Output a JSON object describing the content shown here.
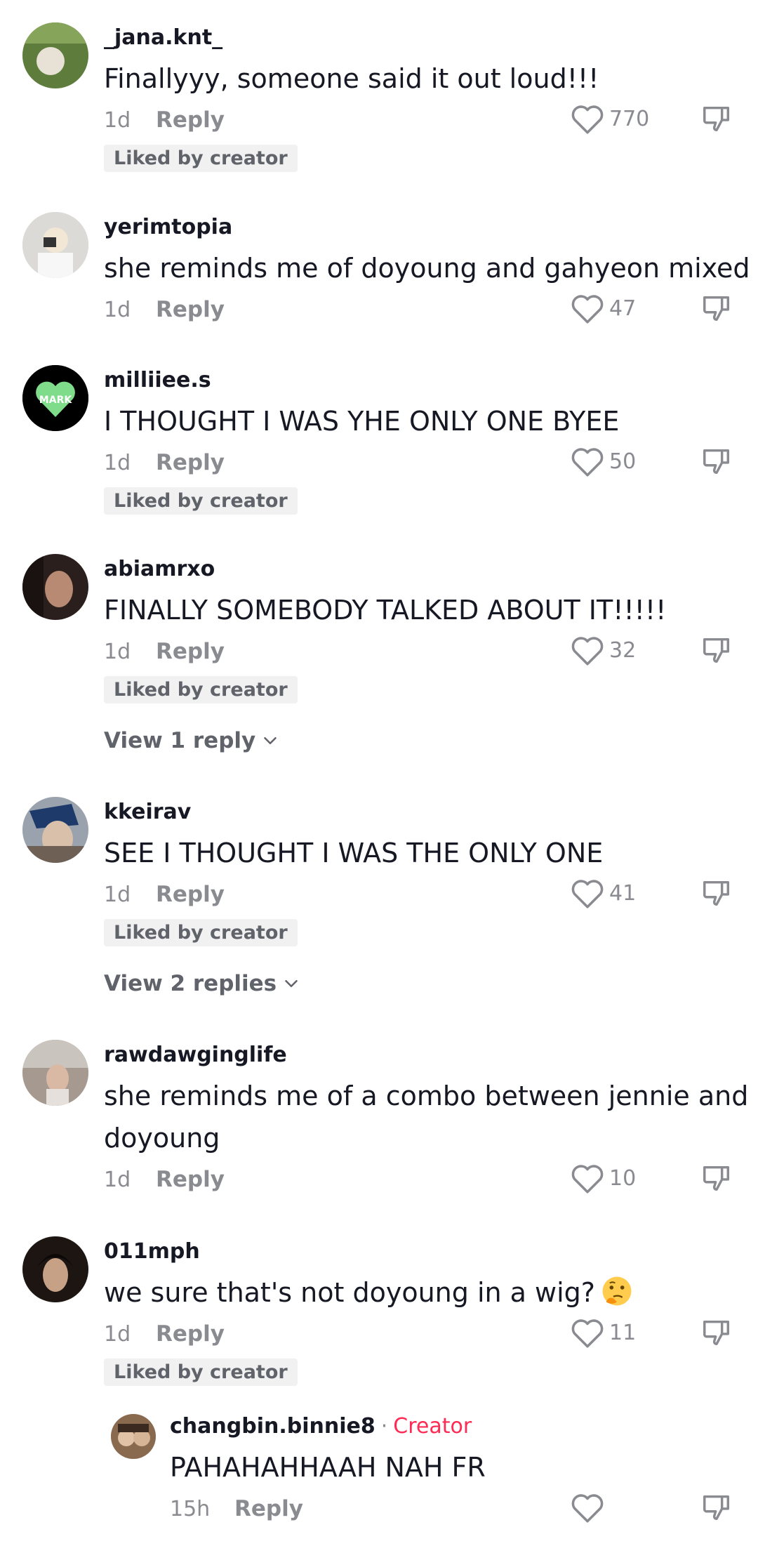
{
  "comments": [
    {
      "username": "_jana.knt_",
      "text": "Finallyyy, someone said it out loud!!!",
      "time": "1d",
      "reply": "Reply",
      "likes": "770",
      "badge": "Liked by creator",
      "avatar_color": "#5a7a3a"
    },
    {
      "username": "yerimtopia",
      "text": "she reminds me of doyoung and gahyeon mixed",
      "time": "1d",
      "reply": "Reply",
      "likes": "47",
      "avatar_color": "#d8d6d2"
    },
    {
      "username": "milliiee.s",
      "text": "I THOUGHT I WAS YHE ONLY ONE BYEE",
      "time": "1d",
      "reply": "Reply",
      "likes": "50",
      "badge": "Liked by creator",
      "avatar_color": "#000000"
    },
    {
      "username": "abiamrxo",
      "text": "FINALLY SOMEBODY TALKED ABOUT IT!!!!!",
      "time": "1d",
      "reply": "Reply",
      "likes": "32",
      "badge": "Liked by creator",
      "view_replies": "View 1 reply",
      "avatar_color": "#3a2a26"
    },
    {
      "username": "kkeirav",
      "text": "SEE I THOUGHT I WAS THE ONLY ONE",
      "time": "1d",
      "reply": "Reply",
      "likes": "41",
      "badge": "Liked by creator",
      "view_replies": "View 2 replies",
      "avatar_color": "#6b7684"
    },
    {
      "username": "rawdawginglife",
      "text": "she reminds me of a combo between jennie and",
      "text2": "doyoung",
      "time": "1d",
      "reply": "Reply",
      "likes": "10",
      "avatar_color": "#8c8580"
    },
    {
      "username": "011mph",
      "text": "we sure that's not doyoung in a wig?",
      "time": "1d",
      "reply": "Reply",
      "likes": "11",
      "badge": "Liked by creator",
      "avatar_color": "#2c2420",
      "emoji": "thinking-face-icon"
    }
  ],
  "creator_reply": {
    "username": "changbin.binnie8",
    "dot": "·",
    "creator_label": "Creator",
    "text": "PAHAHAHHAAH NAH FR",
    "time": "15h",
    "reply": "Reply",
    "avatar_color": "#a57a52"
  },
  "colors": {
    "accent": "#fe2c55",
    "muted": "#8a8b91",
    "badge_bg": "#f1f1f2"
  }
}
